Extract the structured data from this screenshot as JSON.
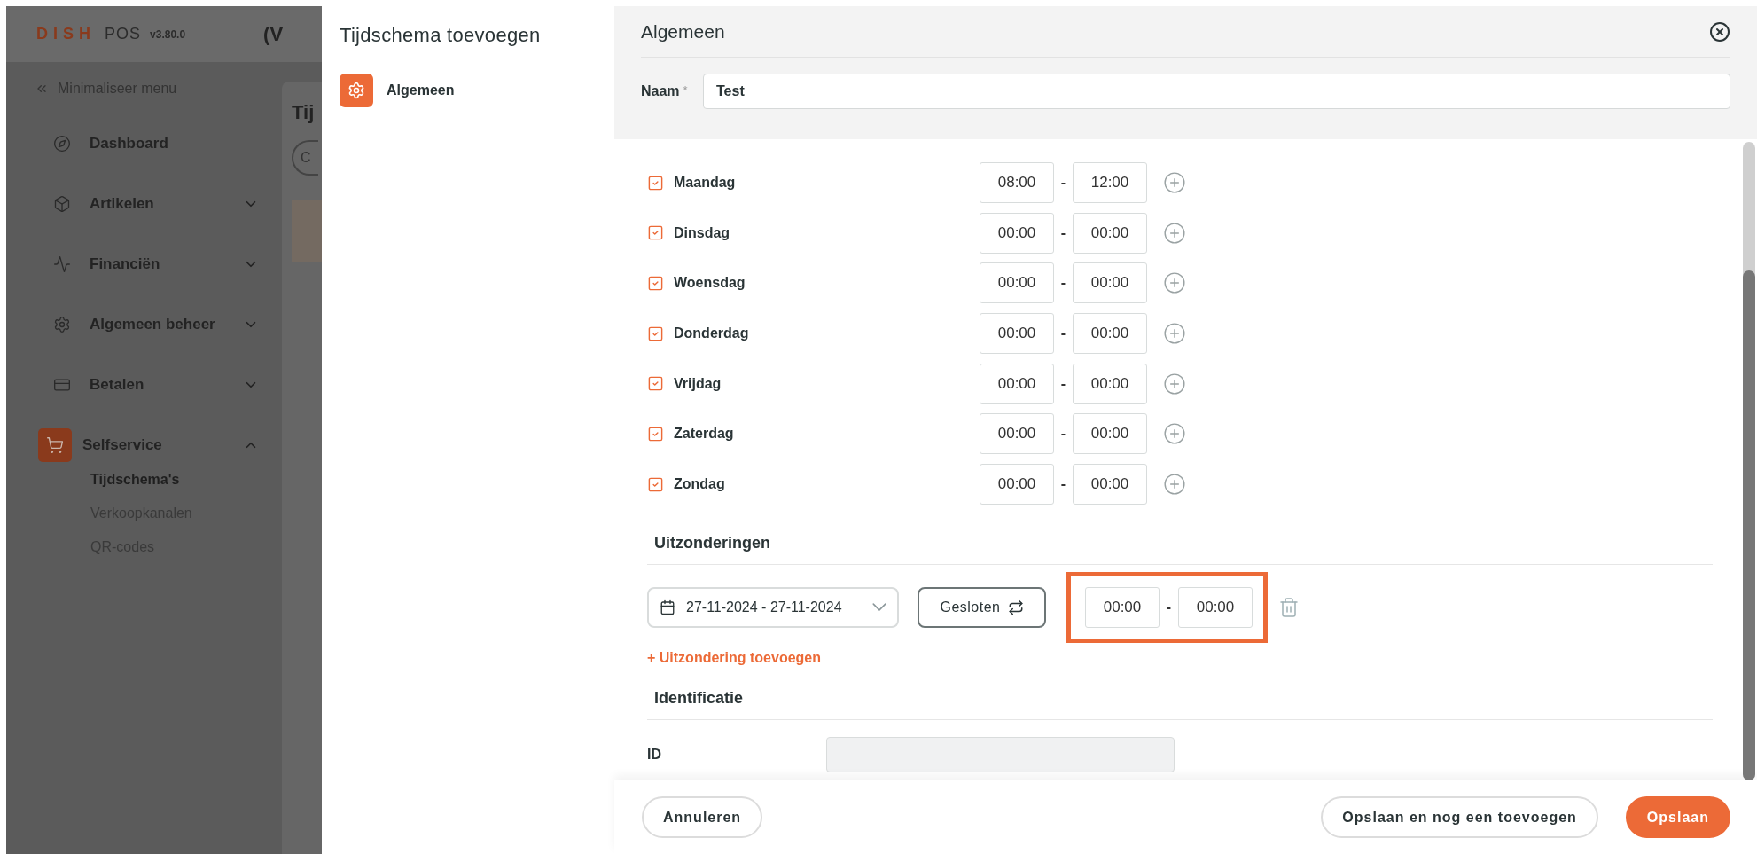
{
  "app": {
    "brand_dish": "DISH",
    "brand_pos": "POS",
    "version": "v3.80.0",
    "header_title": "(V"
  },
  "sidebar": {
    "minimize": "Minimaliseer menu",
    "items": [
      {
        "label": "Dashboard",
        "selected": false
      },
      {
        "label": "Artikelen",
        "expanded": false,
        "selected": false
      },
      {
        "label": "Financiën",
        "expanded": false,
        "selected": false
      },
      {
        "label": "Algemeen beheer",
        "expanded": false,
        "selected": false
      },
      {
        "label": "Betalen",
        "expanded": false,
        "selected": false
      },
      {
        "label": "Selfservice",
        "expanded": true,
        "selected": true,
        "children": [
          {
            "label": "Tijdschema's",
            "selected": true
          },
          {
            "label": "Verkoopkanalen",
            "selected": false
          },
          {
            "label": "QR-codes",
            "selected": false
          }
        ]
      }
    ]
  },
  "background_page": {
    "title": "Tij",
    "button": "C"
  },
  "panel": {
    "title": "Tijdschema toevoegen",
    "nav": [
      {
        "label": "Algemeen",
        "selected": true
      }
    ]
  },
  "form": {
    "title": "Algemeen",
    "name_label": "Naam",
    "required_mark": "*",
    "name_value": "Test",
    "days": [
      {
        "label": "Maandag",
        "checked": true,
        "from": "08:00",
        "dash": "-",
        "to": "12:00"
      },
      {
        "label": "Dinsdag",
        "checked": true,
        "from": "00:00",
        "dash": "-",
        "to": "00:00"
      },
      {
        "label": "Woensdag",
        "checked": true,
        "from": "00:00",
        "dash": "-",
        "to": "00:00"
      },
      {
        "label": "Donderdag",
        "checked": true,
        "from": "00:00",
        "dash": "-",
        "to": "00:00"
      },
      {
        "label": "Vrijdag",
        "checked": true,
        "from": "00:00",
        "dash": "-",
        "to": "00:00"
      },
      {
        "label": "Zaterdag",
        "checked": true,
        "from": "00:00",
        "dash": "-",
        "to": "00:00"
      },
      {
        "label": "Zondag",
        "checked": true,
        "from": "00:00",
        "dash": "-",
        "to": "00:00"
      }
    ],
    "exceptions": {
      "title": "Uitzonderingen",
      "items": [
        {
          "date_range": "27-11-2024 - 27-11-2024",
          "mode": "Gesloten",
          "from": "00:00",
          "dash": "-",
          "to": "00:00",
          "highlighted": true
        }
      ],
      "add_link": "+ Uitzondering toevoegen"
    },
    "identification": {
      "title": "Identificatie",
      "id_label": "ID"
    }
  },
  "footer": {
    "cancel": "Annuleren",
    "save_and_new": "Opslaan en nog een toevoegen",
    "save": "Opslaan"
  }
}
